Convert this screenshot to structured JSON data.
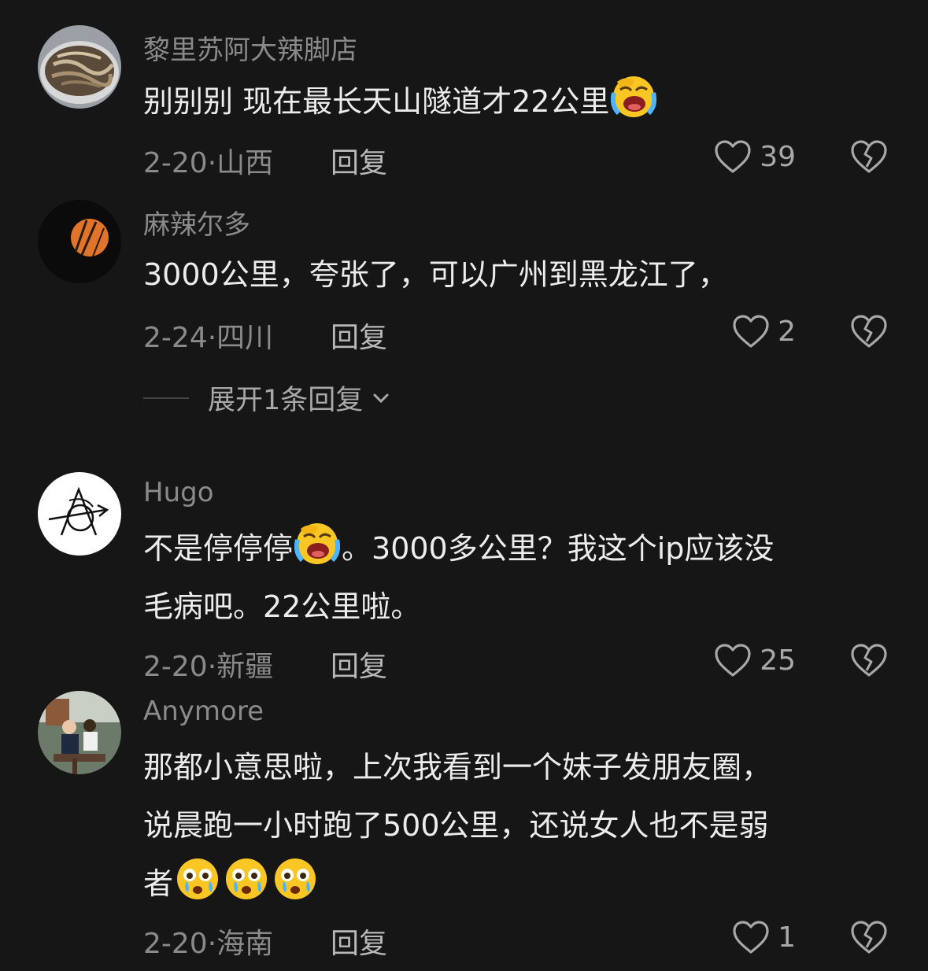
{
  "comments": [
    {
      "username": "黎里苏阿大辣脚店",
      "text_parts": [
        "别别别 现在最长天山隧道才22公里",
        ""
      ],
      "emoji": "grimacing-laugh-cry-emoji",
      "date": "2-20",
      "location": "山西",
      "reply_label": "回复",
      "likes": "39"
    },
    {
      "username": "麻辣尔多",
      "text": "3000公里，夸张了，可以广州到黑龙江了，",
      "date": "2-24",
      "location": "四川",
      "reply_label": "回复",
      "likes": "2",
      "expand_label": "展开1条回复"
    },
    {
      "username": "Hugo",
      "text_before": "不是停停停",
      "text_after_line1": "。3000多公里？我这个ip应该没",
      "text_line2": "毛病吧。22公里啦。",
      "emoji": "grimacing-laugh-cry-emoji",
      "date": "2-20",
      "location": "新疆",
      "reply_label": "回复",
      "likes": "25"
    },
    {
      "username": "Anymore",
      "text_line1": "那都小意思啦，上次我看到一个妹子发朋友圈，",
      "text_line2": "说晨跑一小时跑了500公里，还说女人也不是弱",
      "text_line3": "者",
      "emoji": "shocked-tearful-emoji",
      "date": "2-20",
      "location": "海南",
      "reply_label": "回复",
      "likes": "1"
    }
  ],
  "colors": {
    "background": "#161616",
    "text": "#ececec",
    "muted": "#8a8a8a"
  }
}
